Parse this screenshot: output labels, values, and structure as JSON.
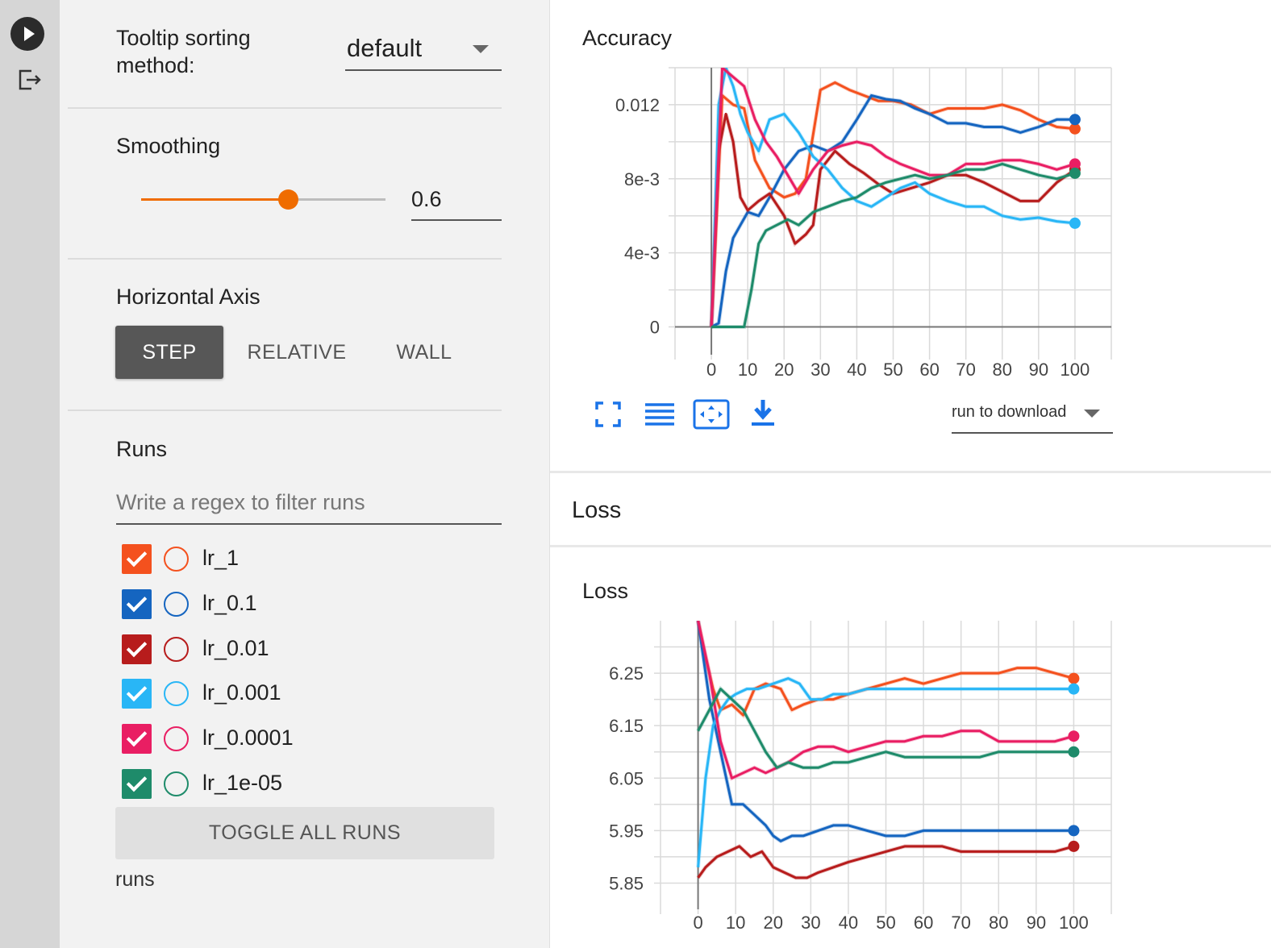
{
  "sidebar": {
    "tooltip_label": "Tooltip sorting method:",
    "tooltip_value": "default",
    "smoothing_label": "Smoothing",
    "smoothing_value": "0.6",
    "smoothing_fraction": 0.6,
    "horizontal_axis_label": "Horizontal Axis",
    "axis_buttons": [
      {
        "label": "STEP",
        "active": true
      },
      {
        "label": "RELATIVE",
        "active": false
      },
      {
        "label": "WALL",
        "active": false
      }
    ],
    "runs_label": "Runs",
    "regex_placeholder": "Write a regex to filter runs",
    "runs": [
      {
        "name": "lr_1",
        "color": "#f4511e",
        "checked": true
      },
      {
        "name": "lr_0.1",
        "color": "#1565c0",
        "checked": true
      },
      {
        "name": "lr_0.01",
        "color": "#b71c1c",
        "checked": true
      },
      {
        "name": "lr_0.001",
        "color": "#29b6f6",
        "checked": true
      },
      {
        "name": "lr_0.0001",
        "color": "#e91e63",
        "checked": true
      },
      {
        "name": "lr_1e-05",
        "color": "#1e8b6a",
        "checked": true
      }
    ],
    "toggle_all_label": "TOGGLE ALL RUNS",
    "footer": "runs"
  },
  "main": {
    "accuracy_chart_title": "Accuracy",
    "loss_section_title": "Loss",
    "loss_chart_title": "Loss",
    "run_to_download": "run to download"
  },
  "chart_data": [
    {
      "type": "line",
      "title": "Accuracy",
      "xlabel": "",
      "ylabel": "",
      "xlim": [
        -10,
        110
      ],
      "ylim": [
        -0.0015,
        0.014
      ],
      "x_ticks": [
        0,
        10,
        20,
        30,
        40,
        50,
        60,
        70,
        80,
        90,
        100
      ],
      "x_tick_labels": [
        "0",
        "10",
        "20",
        "30",
        "40",
        "50",
        "60",
        "70",
        "80",
        "90",
        "100"
      ],
      "y_ticks": [
        0,
        0.004,
        0.008,
        0.012
      ],
      "y_tick_labels": [
        "0",
        "4e-3",
        "8e-3",
        "0.012"
      ],
      "grid": true,
      "series": [
        {
          "name": "lr_1",
          "color": "#f4511e",
          "x": [
            0,
            3,
            6,
            9,
            12,
            16,
            20,
            23,
            26,
            30,
            34,
            38,
            42,
            46,
            50,
            55,
            60,
            65,
            70,
            75,
            80,
            85,
            90,
            95,
            100
          ],
          "y": [
            0,
            0.0125,
            0.012,
            0.0118,
            0.009,
            0.0075,
            0.007,
            0.0072,
            0.008,
            0.0128,
            0.0132,
            0.0128,
            0.0125,
            0.0122,
            0.0122,
            0.012,
            0.0115,
            0.0118,
            0.0118,
            0.0118,
            0.012,
            0.0117,
            0.0112,
            0.0108,
            0.0107
          ]
        },
        {
          "name": "lr_0.1",
          "color": "#1565c0",
          "x": [
            0,
            2,
            4,
            6,
            8,
            10,
            13,
            16,
            20,
            24,
            28,
            32,
            36,
            40,
            44,
            48,
            52,
            56,
            60,
            65,
            70,
            75,
            80,
            85,
            90,
            95,
            100
          ],
          "y": [
            0,
            0.0002,
            0.003,
            0.0048,
            0.0055,
            0.0062,
            0.006,
            0.007,
            0.0085,
            0.0095,
            0.0098,
            0.0095,
            0.01,
            0.0112,
            0.0125,
            0.0123,
            0.0122,
            0.0118,
            0.0115,
            0.011,
            0.011,
            0.0108,
            0.0108,
            0.0105,
            0.0108,
            0.0112,
            0.0112
          ]
        },
        {
          "name": "lr_0.01",
          "color": "#b71c1c",
          "x": [
            0,
            2,
            4,
            6,
            8,
            10,
            13,
            16,
            20,
            23,
            26,
            28,
            30,
            34,
            38,
            42,
            46,
            50,
            55,
            60,
            65,
            70,
            75,
            80,
            85,
            90,
            95,
            100
          ],
          "y": [
            0,
            0.0095,
            0.0115,
            0.01,
            0.007,
            0.0063,
            0.0068,
            0.0072,
            0.006,
            0.0045,
            0.005,
            0.0055,
            0.0085,
            0.0095,
            0.0088,
            0.0083,
            0.0077,
            0.0072,
            0.0075,
            0.0078,
            0.0082,
            0.0082,
            0.0078,
            0.0073,
            0.0068,
            0.0068,
            0.0078,
            0.0085
          ]
        },
        {
          "name": "lr_0.001",
          "color": "#29b6f6",
          "x": [
            0,
            2,
            4,
            6,
            8,
            10,
            13,
            16,
            20,
            24,
            28,
            32,
            36,
            40,
            44,
            48,
            52,
            56,
            60,
            65,
            70,
            75,
            80,
            85,
            90,
            95,
            100
          ],
          "y": [
            0,
            0.012,
            0.014,
            0.013,
            0.0115,
            0.0105,
            0.0095,
            0.0112,
            0.0115,
            0.0105,
            0.0092,
            0.0085,
            0.0075,
            0.0068,
            0.0065,
            0.007,
            0.0075,
            0.0078,
            0.0072,
            0.0068,
            0.0065,
            0.0065,
            0.006,
            0.0058,
            0.0059,
            0.0057,
            0.0056
          ]
        },
        {
          "name": "lr_0.0001",
          "color": "#e91e63",
          "x": [
            0,
            3,
            6,
            9,
            12,
            15,
            18,
            21,
            24,
            28,
            32,
            36,
            40,
            44,
            48,
            52,
            56,
            60,
            65,
            70,
            75,
            80,
            85,
            90,
            95,
            100
          ],
          "y": [
            0,
            0.014,
            0.0135,
            0.013,
            0.0112,
            0.01,
            0.0092,
            0.0082,
            0.0072,
            0.0085,
            0.0095,
            0.0098,
            0.01,
            0.0098,
            0.0092,
            0.0088,
            0.0085,
            0.0082,
            0.0082,
            0.0088,
            0.0088,
            0.009,
            0.009,
            0.0088,
            0.0085,
            0.0088
          ]
        },
        {
          "name": "lr_1e-05",
          "color": "#1e8b6a",
          "x": [
            0,
            5,
            9,
            11,
            13,
            15,
            18,
            21,
            24,
            28,
            32,
            36,
            40,
            44,
            48,
            52,
            56,
            60,
            65,
            70,
            75,
            80,
            85,
            90,
            95,
            100
          ],
          "y": [
            0,
            0,
            0,
            0.002,
            0.0045,
            0.0052,
            0.0055,
            0.0058,
            0.0055,
            0.0062,
            0.0065,
            0.0068,
            0.007,
            0.0075,
            0.0078,
            0.008,
            0.0082,
            0.008,
            0.0082,
            0.0085,
            0.0085,
            0.0088,
            0.0085,
            0.0082,
            0.008,
            0.0083
          ]
        }
      ]
    },
    {
      "type": "line",
      "title": "Loss",
      "xlabel": "",
      "ylabel": "",
      "xlim": [
        -10,
        110
      ],
      "ylim": [
        5.8,
        6.35
      ],
      "x_ticks": [
        0,
        10,
        20,
        30,
        40,
        50,
        60,
        70,
        80,
        90,
        100
      ],
      "x_tick_labels": [
        "0",
        "10",
        "20",
        "30",
        "40",
        "50",
        "60",
        "70",
        "80",
        "90",
        "100"
      ],
      "y_ticks": [
        5.85,
        5.95,
        6.05,
        6.15,
        6.25
      ],
      "y_tick_labels": [
        "5.85",
        "5.95",
        "6.05",
        "6.15",
        "6.25"
      ],
      "grid": true,
      "series": [
        {
          "name": "lr_1",
          "color": "#f4511e",
          "x": [
            0,
            2,
            4,
            6,
            9,
            12,
            15,
            18,
            22,
            25,
            28,
            32,
            36,
            40,
            45,
            50,
            55,
            60,
            65,
            70,
            75,
            80,
            85,
            90,
            95,
            100
          ],
          "y": [
            6.35,
            6.28,
            6.22,
            6.18,
            6.19,
            6.17,
            6.22,
            6.23,
            6.22,
            6.18,
            6.19,
            6.2,
            6.2,
            6.21,
            6.22,
            6.23,
            6.24,
            6.23,
            6.24,
            6.25,
            6.25,
            6.25,
            6.26,
            6.26,
            6.25,
            6.24
          ]
        },
        {
          "name": "lr_0.1",
          "color": "#1565c0",
          "x": [
            0,
            3,
            6,
            9,
            12,
            15,
            18,
            20,
            22,
            25,
            28,
            32,
            36,
            40,
            45,
            50,
            55,
            60,
            65,
            70,
            75,
            80,
            85,
            90,
            95,
            100
          ],
          "y": [
            6.35,
            6.2,
            6.1,
            6.0,
            6.0,
            5.98,
            5.96,
            5.94,
            5.93,
            5.94,
            5.94,
            5.95,
            5.96,
            5.96,
            5.95,
            5.94,
            5.94,
            5.95,
            5.95,
            5.95,
            5.95,
            5.95,
            5.95,
            5.95,
            5.95,
            5.95
          ]
        },
        {
          "name": "lr_0.01",
          "color": "#b71c1c",
          "x": [
            0,
            2,
            5,
            8,
            11,
            14,
            17,
            20,
            23,
            26,
            29,
            32,
            36,
            40,
            45,
            50,
            55,
            60,
            65,
            70,
            75,
            80,
            85,
            90,
            95,
            100
          ],
          "y": [
            5.86,
            5.88,
            5.9,
            5.91,
            5.92,
            5.9,
            5.91,
            5.88,
            5.87,
            5.86,
            5.86,
            5.87,
            5.88,
            5.89,
            5.9,
            5.91,
            5.92,
            5.92,
            5.92,
            5.91,
            5.91,
            5.91,
            5.91,
            5.91,
            5.91,
            5.92
          ]
        },
        {
          "name": "lr_0.001",
          "color": "#29b6f6",
          "x": [
            0,
            2,
            4,
            6,
            8,
            10,
            13,
            16,
            20,
            24,
            27,
            30,
            33,
            36,
            40,
            45,
            50,
            55,
            60,
            65,
            70,
            75,
            80,
            85,
            90,
            95,
            100
          ],
          "y": [
            5.88,
            6.05,
            6.15,
            6.18,
            6.2,
            6.21,
            6.22,
            6.22,
            6.23,
            6.24,
            6.23,
            6.2,
            6.2,
            6.21,
            6.21,
            6.22,
            6.22,
            6.22,
            6.22,
            6.22,
            6.22,
            6.22,
            6.22,
            6.22,
            6.22,
            6.22,
            6.22
          ]
        },
        {
          "name": "lr_0.0001",
          "color": "#e91e63",
          "x": [
            0,
            3,
            6,
            9,
            12,
            15,
            18,
            21,
            24,
            28,
            32,
            36,
            40,
            45,
            50,
            55,
            60,
            65,
            70,
            75,
            80,
            85,
            90,
            95,
            100
          ],
          "y": [
            6.35,
            6.25,
            6.12,
            6.05,
            6.06,
            6.07,
            6.06,
            6.07,
            6.08,
            6.1,
            6.11,
            6.11,
            6.1,
            6.11,
            6.12,
            6.12,
            6.13,
            6.13,
            6.14,
            6.14,
            6.12,
            6.12,
            6.12,
            6.12,
            6.13
          ]
        },
        {
          "name": "lr_1e-05",
          "color": "#1e8b6a",
          "x": [
            0,
            3,
            6,
            9,
            12,
            15,
            18,
            21,
            24,
            28,
            32,
            36,
            40,
            45,
            50,
            55,
            60,
            65,
            70,
            75,
            80,
            85,
            90,
            95,
            100
          ],
          "y": [
            6.14,
            6.18,
            6.22,
            6.2,
            6.18,
            6.14,
            6.1,
            6.07,
            6.08,
            6.07,
            6.07,
            6.08,
            6.08,
            6.09,
            6.1,
            6.09,
            6.09,
            6.09,
            6.09,
            6.09,
            6.1,
            6.1,
            6.1,
            6.1,
            6.1
          ]
        }
      ]
    }
  ]
}
